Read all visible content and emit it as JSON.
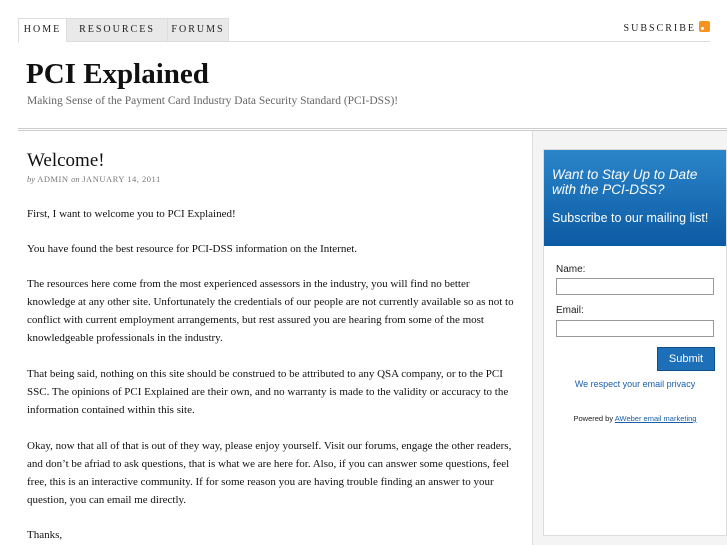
{
  "nav": {
    "tabs": [
      {
        "label": "HOME",
        "active": true
      },
      {
        "label": "RESOURCES",
        "active": false
      },
      {
        "label": "FORUMS",
        "active": false
      }
    ],
    "subscribe_label": "SUBSCRIBE",
    "subscribe_icon": "rss-icon"
  },
  "site": {
    "title": "PCI Explained",
    "tagline": "Making Sense of the Payment Card Industry Data Security Standard (PCI-DSS)!"
  },
  "post": {
    "title": "Welcome!",
    "byline": {
      "by": "by",
      "author": "ADMIN",
      "on": "on",
      "date": "JANUARY 14, 2011"
    },
    "paragraphs": [
      "First, I want to welcome you to PCI Explained!",
      "You have found the best resource for PCI-DSS information on the Internet.",
      "The resources here come from the most experienced assessors in the industry, you will find no better knowledge at any other site.  Unfortunately the credentials of our people are not currently available so as not to conflict with current employment arrangements, but rest assured you are hearing from some of the most knowledgeable professionals in the industry.",
      "That being said, nothing on this site should be construed to be attributed to any QSA company, or to the PCI SSC.  The opinions of PCI Explained are their own, and no warranty is made to the validity or accuracy to the information contained within this site.",
      "Okay, now that all of that is out of they way, please enjoy yourself.  Visit our forums, engage the other readers, and don’t be afriad to ask questions, that is what we are here for.  Also, if you can answer some questions, feel free, this is an interactive community.  If for some reason you are having trouble finding an answer to your question, you can email me directly.",
      "Thanks,"
    ]
  },
  "optin": {
    "heading": "Want to Stay Up to Date with the PCI-DSS?",
    "subheading": "Subscribe to our mailing list!",
    "name_label": "Name:",
    "name_value": "",
    "email_label": "Email:",
    "email_value": "",
    "submit_label": "Submit",
    "privacy_text": "We respect your email privacy",
    "powered_by": "Powered by",
    "powered_link": "AWeber email marketing"
  },
  "colors": {
    "optin_header": "#1d6fb8",
    "link": "#1a5fa8",
    "rss": "#f7931e"
  }
}
